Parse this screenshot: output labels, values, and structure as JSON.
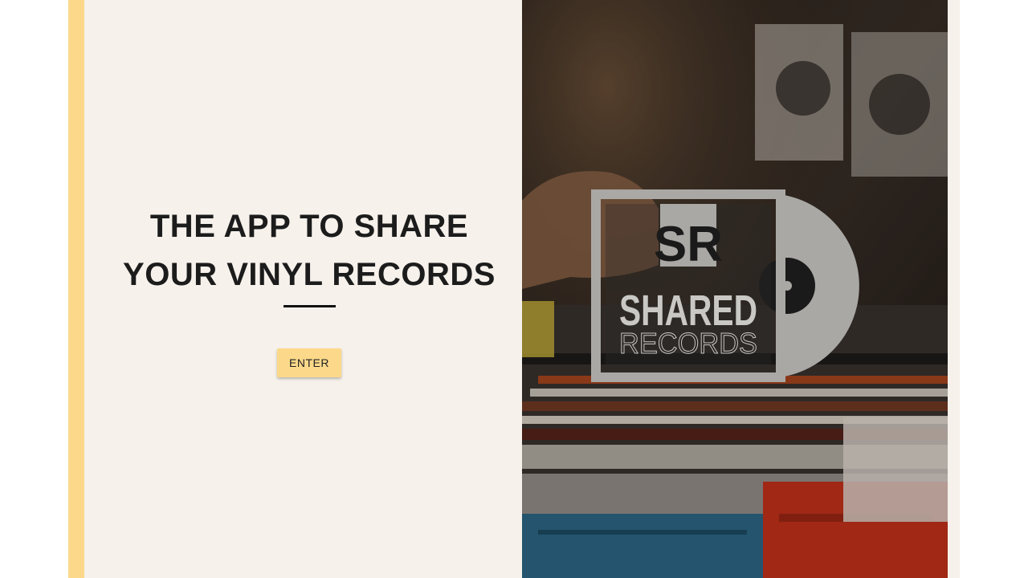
{
  "hero": {
    "headline_line1": "THE APP TO SHARE",
    "headline_line2": "YOUR VINYL RECORDS",
    "enter_label": "ENTER"
  },
  "logo": {
    "monogram": "SR",
    "wordmark_top": "SHARED",
    "wordmark_bottom": "RECORDS"
  },
  "colors": {
    "accent": "#fcd98a",
    "panel_bg": "#f6f1eb",
    "text": "#1c1c1c",
    "logo_gray": "#a9a8a5"
  },
  "icons": {
    "logo": "vinyl-record-sleeve-logo"
  }
}
